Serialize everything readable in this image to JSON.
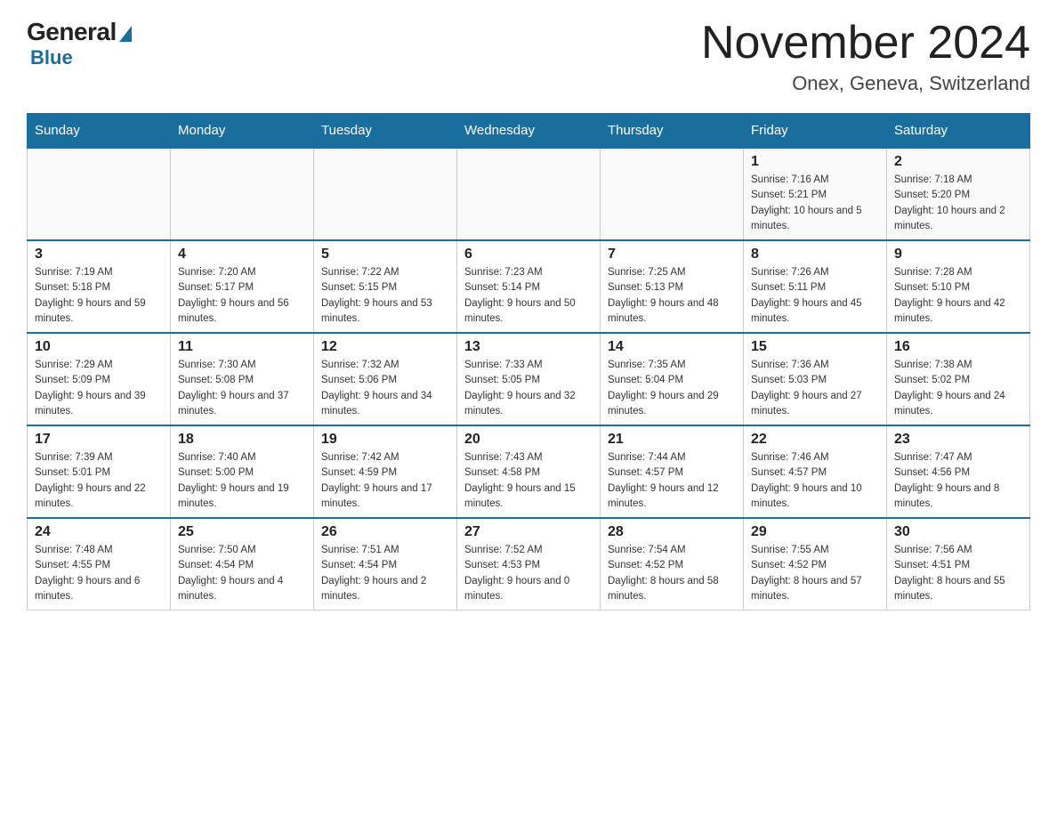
{
  "header": {
    "logo_general": "General",
    "logo_blue": "Blue",
    "month_title": "November 2024",
    "location": "Onex, Geneva, Switzerland"
  },
  "weekdays": [
    "Sunday",
    "Monday",
    "Tuesday",
    "Wednesday",
    "Thursday",
    "Friday",
    "Saturday"
  ],
  "weeks": [
    {
      "days": [
        {
          "num": "",
          "sunrise": "",
          "sunset": "",
          "daylight": ""
        },
        {
          "num": "",
          "sunrise": "",
          "sunset": "",
          "daylight": ""
        },
        {
          "num": "",
          "sunrise": "",
          "sunset": "",
          "daylight": ""
        },
        {
          "num": "",
          "sunrise": "",
          "sunset": "",
          "daylight": ""
        },
        {
          "num": "",
          "sunrise": "",
          "sunset": "",
          "daylight": ""
        },
        {
          "num": "1",
          "sunrise": "Sunrise: 7:16 AM",
          "sunset": "Sunset: 5:21 PM",
          "daylight": "Daylight: 10 hours and 5 minutes."
        },
        {
          "num": "2",
          "sunrise": "Sunrise: 7:18 AM",
          "sunset": "Sunset: 5:20 PM",
          "daylight": "Daylight: 10 hours and 2 minutes."
        }
      ]
    },
    {
      "days": [
        {
          "num": "3",
          "sunrise": "Sunrise: 7:19 AM",
          "sunset": "Sunset: 5:18 PM",
          "daylight": "Daylight: 9 hours and 59 minutes."
        },
        {
          "num": "4",
          "sunrise": "Sunrise: 7:20 AM",
          "sunset": "Sunset: 5:17 PM",
          "daylight": "Daylight: 9 hours and 56 minutes."
        },
        {
          "num": "5",
          "sunrise": "Sunrise: 7:22 AM",
          "sunset": "Sunset: 5:15 PM",
          "daylight": "Daylight: 9 hours and 53 minutes."
        },
        {
          "num": "6",
          "sunrise": "Sunrise: 7:23 AM",
          "sunset": "Sunset: 5:14 PM",
          "daylight": "Daylight: 9 hours and 50 minutes."
        },
        {
          "num": "7",
          "sunrise": "Sunrise: 7:25 AM",
          "sunset": "Sunset: 5:13 PM",
          "daylight": "Daylight: 9 hours and 48 minutes."
        },
        {
          "num": "8",
          "sunrise": "Sunrise: 7:26 AM",
          "sunset": "Sunset: 5:11 PM",
          "daylight": "Daylight: 9 hours and 45 minutes."
        },
        {
          "num": "9",
          "sunrise": "Sunrise: 7:28 AM",
          "sunset": "Sunset: 5:10 PM",
          "daylight": "Daylight: 9 hours and 42 minutes."
        }
      ]
    },
    {
      "days": [
        {
          "num": "10",
          "sunrise": "Sunrise: 7:29 AM",
          "sunset": "Sunset: 5:09 PM",
          "daylight": "Daylight: 9 hours and 39 minutes."
        },
        {
          "num": "11",
          "sunrise": "Sunrise: 7:30 AM",
          "sunset": "Sunset: 5:08 PM",
          "daylight": "Daylight: 9 hours and 37 minutes."
        },
        {
          "num": "12",
          "sunrise": "Sunrise: 7:32 AM",
          "sunset": "Sunset: 5:06 PM",
          "daylight": "Daylight: 9 hours and 34 minutes."
        },
        {
          "num": "13",
          "sunrise": "Sunrise: 7:33 AM",
          "sunset": "Sunset: 5:05 PM",
          "daylight": "Daylight: 9 hours and 32 minutes."
        },
        {
          "num": "14",
          "sunrise": "Sunrise: 7:35 AM",
          "sunset": "Sunset: 5:04 PM",
          "daylight": "Daylight: 9 hours and 29 minutes."
        },
        {
          "num": "15",
          "sunrise": "Sunrise: 7:36 AM",
          "sunset": "Sunset: 5:03 PM",
          "daylight": "Daylight: 9 hours and 27 minutes."
        },
        {
          "num": "16",
          "sunrise": "Sunrise: 7:38 AM",
          "sunset": "Sunset: 5:02 PM",
          "daylight": "Daylight: 9 hours and 24 minutes."
        }
      ]
    },
    {
      "days": [
        {
          "num": "17",
          "sunrise": "Sunrise: 7:39 AM",
          "sunset": "Sunset: 5:01 PM",
          "daylight": "Daylight: 9 hours and 22 minutes."
        },
        {
          "num": "18",
          "sunrise": "Sunrise: 7:40 AM",
          "sunset": "Sunset: 5:00 PM",
          "daylight": "Daylight: 9 hours and 19 minutes."
        },
        {
          "num": "19",
          "sunrise": "Sunrise: 7:42 AM",
          "sunset": "Sunset: 4:59 PM",
          "daylight": "Daylight: 9 hours and 17 minutes."
        },
        {
          "num": "20",
          "sunrise": "Sunrise: 7:43 AM",
          "sunset": "Sunset: 4:58 PM",
          "daylight": "Daylight: 9 hours and 15 minutes."
        },
        {
          "num": "21",
          "sunrise": "Sunrise: 7:44 AM",
          "sunset": "Sunset: 4:57 PM",
          "daylight": "Daylight: 9 hours and 12 minutes."
        },
        {
          "num": "22",
          "sunrise": "Sunrise: 7:46 AM",
          "sunset": "Sunset: 4:57 PM",
          "daylight": "Daylight: 9 hours and 10 minutes."
        },
        {
          "num": "23",
          "sunrise": "Sunrise: 7:47 AM",
          "sunset": "Sunset: 4:56 PM",
          "daylight": "Daylight: 9 hours and 8 minutes."
        }
      ]
    },
    {
      "days": [
        {
          "num": "24",
          "sunrise": "Sunrise: 7:48 AM",
          "sunset": "Sunset: 4:55 PM",
          "daylight": "Daylight: 9 hours and 6 minutes."
        },
        {
          "num": "25",
          "sunrise": "Sunrise: 7:50 AM",
          "sunset": "Sunset: 4:54 PM",
          "daylight": "Daylight: 9 hours and 4 minutes."
        },
        {
          "num": "26",
          "sunrise": "Sunrise: 7:51 AM",
          "sunset": "Sunset: 4:54 PM",
          "daylight": "Daylight: 9 hours and 2 minutes."
        },
        {
          "num": "27",
          "sunrise": "Sunrise: 7:52 AM",
          "sunset": "Sunset: 4:53 PM",
          "daylight": "Daylight: 9 hours and 0 minutes."
        },
        {
          "num": "28",
          "sunrise": "Sunrise: 7:54 AM",
          "sunset": "Sunset: 4:52 PM",
          "daylight": "Daylight: 8 hours and 58 minutes."
        },
        {
          "num": "29",
          "sunrise": "Sunrise: 7:55 AM",
          "sunset": "Sunset: 4:52 PM",
          "daylight": "Daylight: 8 hours and 57 minutes."
        },
        {
          "num": "30",
          "sunrise": "Sunrise: 7:56 AM",
          "sunset": "Sunset: 4:51 PM",
          "daylight": "Daylight: 8 hours and 55 minutes."
        }
      ]
    }
  ]
}
